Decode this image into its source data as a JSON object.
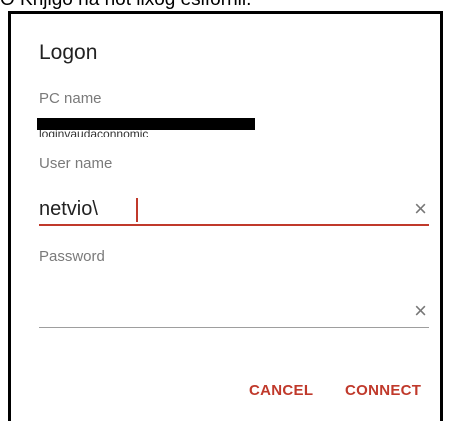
{
  "top_text": "O Knjigo na not lixog esifornil.",
  "dialog": {
    "title": "Logon",
    "pc_name_label": "PC name",
    "pc_name_value": "loginvaudaconnomic",
    "user_name_label": "User name",
    "user_name_value": "netvio\\",
    "password_label": "Password",
    "password_value": "",
    "cancel_label": "CANCEL",
    "connect_label": "CONNECT",
    "clear_glyph": "×"
  },
  "colors": {
    "accent": "#c0392b",
    "label": "#7a7a7a"
  }
}
